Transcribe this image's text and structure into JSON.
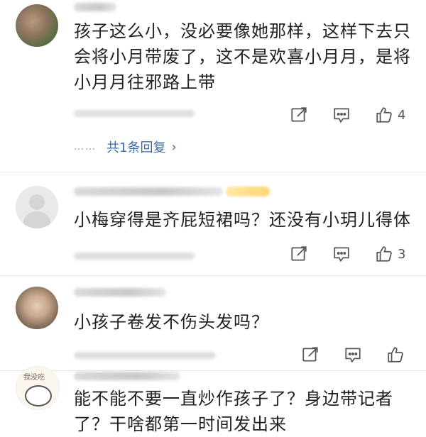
{
  "comments": [
    {
      "text": "孩子这么小，没必要像她那样，这样下去只会将小月带废了，这不是欢喜小月月，是将小月月往邪路上带",
      "likes": "4",
      "replies": {
        "dots": "……",
        "label": "共1条回复"
      }
    },
    {
      "text": "小梅穿得是齐屁短裙吗？还没有小玥儿得体",
      "likes": "3"
    },
    {
      "text": "小孩子卷发不伤头发吗？",
      "likes": ""
    },
    {
      "text": "能不能不要一直炒作孩子了？身边带记者了？干啥都第一时间发出来",
      "avatar_caption": "我没吃"
    }
  ],
  "icons": {
    "share": "share-icon",
    "comment": "comment-icon",
    "like": "thumbs-up-icon",
    "chevron": "chevron-right-icon"
  },
  "colors": {
    "link": "#3d6cad",
    "text": "#222222",
    "icon": "#555555",
    "divider": "#e6e6e6"
  }
}
